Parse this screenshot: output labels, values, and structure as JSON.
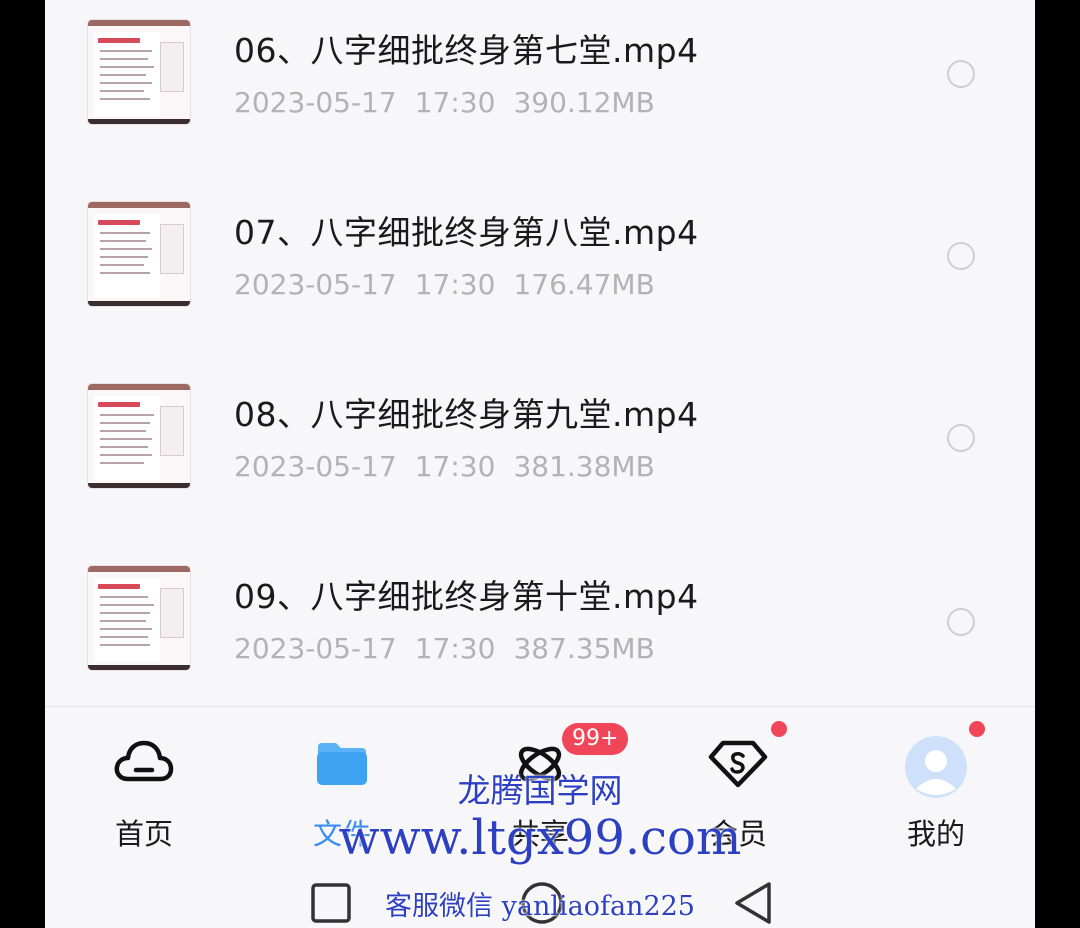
{
  "files": [
    {
      "name": "06、八字细批终身第七堂.mp4",
      "date": "2023-05-17",
      "time": "17:30",
      "size": "390.12MB"
    },
    {
      "name": "07、八字细批终身第八堂.mp4",
      "date": "2023-05-17",
      "time": "17:30",
      "size": "176.47MB"
    },
    {
      "name": "08、八字细批终身第九堂.mp4",
      "date": "2023-05-17",
      "time": "17:30",
      "size": "381.38MB"
    },
    {
      "name": "09、八字细批终身第十堂.mp4",
      "date": "2023-05-17",
      "time": "17:30",
      "size": "387.35MB"
    }
  ],
  "tabbar": {
    "home": {
      "label": "首页",
      "icon": "cloud-icon"
    },
    "files": {
      "label": "文件",
      "icon": "folder-icon"
    },
    "share": {
      "label": "共享",
      "icon": "share-icon",
      "badge": "99+"
    },
    "vip": {
      "label": "会员",
      "icon": "vip-diamond-icon"
    },
    "me": {
      "label": "我的",
      "icon": "avatar-icon"
    },
    "active": "files"
  },
  "watermark": {
    "site_name": "龙腾国学网",
    "url": "www.ltgx99.com",
    "contact": "客服微信 yanliaofan225"
  },
  "colors": {
    "accent": "#3b8ef0",
    "badge": "#f0465a",
    "watermark": "#2d3fc2",
    "meta_text": "#b3b3b3"
  }
}
